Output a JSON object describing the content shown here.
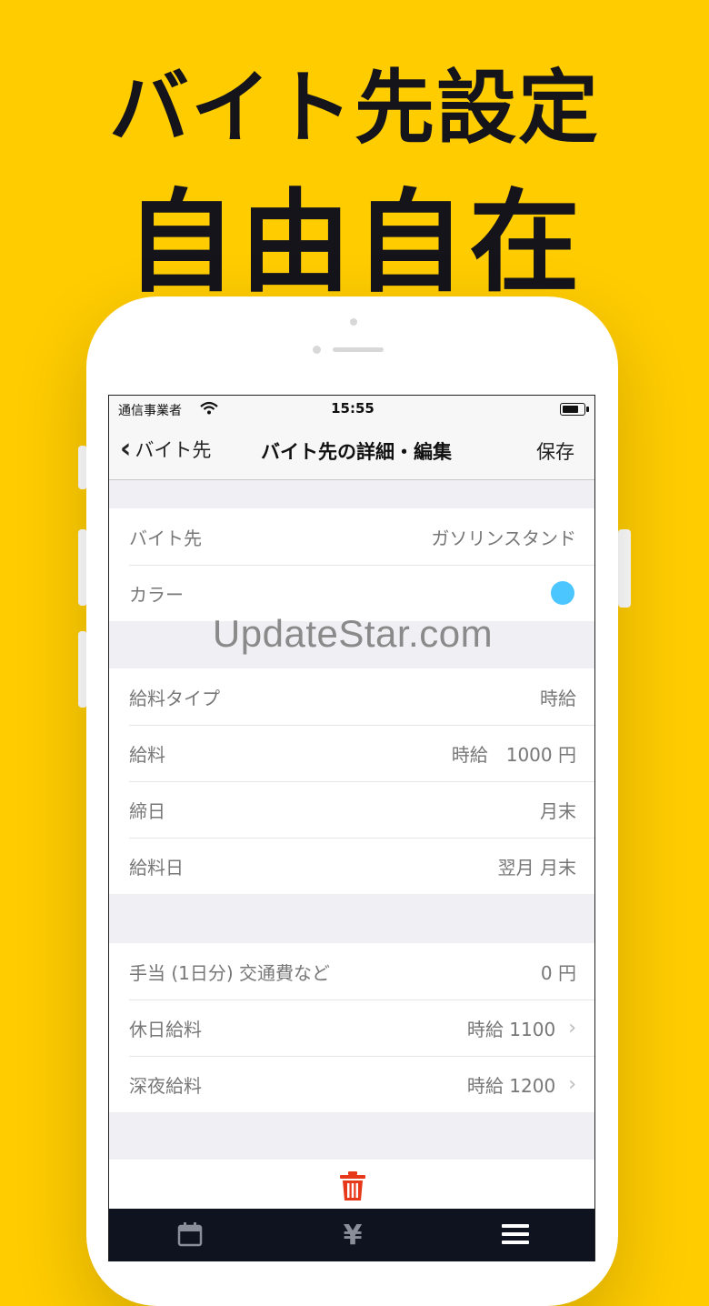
{
  "promo": {
    "line1": "バイト先設定",
    "line2": "自由自在"
  },
  "status_bar": {
    "carrier": "通信事業者",
    "time": "15:55"
  },
  "nav": {
    "back_label": "バイト先",
    "title": "バイト先の詳細・編集",
    "save_label": "保存"
  },
  "section1": {
    "workplace_label": "バイト先",
    "workplace_value": "ガソリンスタンド",
    "color_label": "カラー",
    "color_value": "#4cc6ff"
  },
  "section2": {
    "pay_type_label": "給料タイプ",
    "pay_type_value": "時給",
    "pay_label": "給料",
    "pay_value": "時給　1000 円",
    "closing_label": "締日",
    "closing_value": "月末",
    "payday_label": "給料日",
    "payday_value": "翌月 月末"
  },
  "section3": {
    "allowance_label": "手当 (1日分) 交通費など",
    "allowance_value": "0 円",
    "holiday_label": "休日給料",
    "holiday_value": "時給  1100",
    "night_label": "深夜給料",
    "night_value": "時給  1200"
  },
  "watermark": "UpdateStar.com",
  "tabbar": {
    "yen": "¥"
  },
  "colors": {
    "background": "#FFCC00",
    "tabbar": "#0f1320",
    "delete": "#e8381a"
  }
}
